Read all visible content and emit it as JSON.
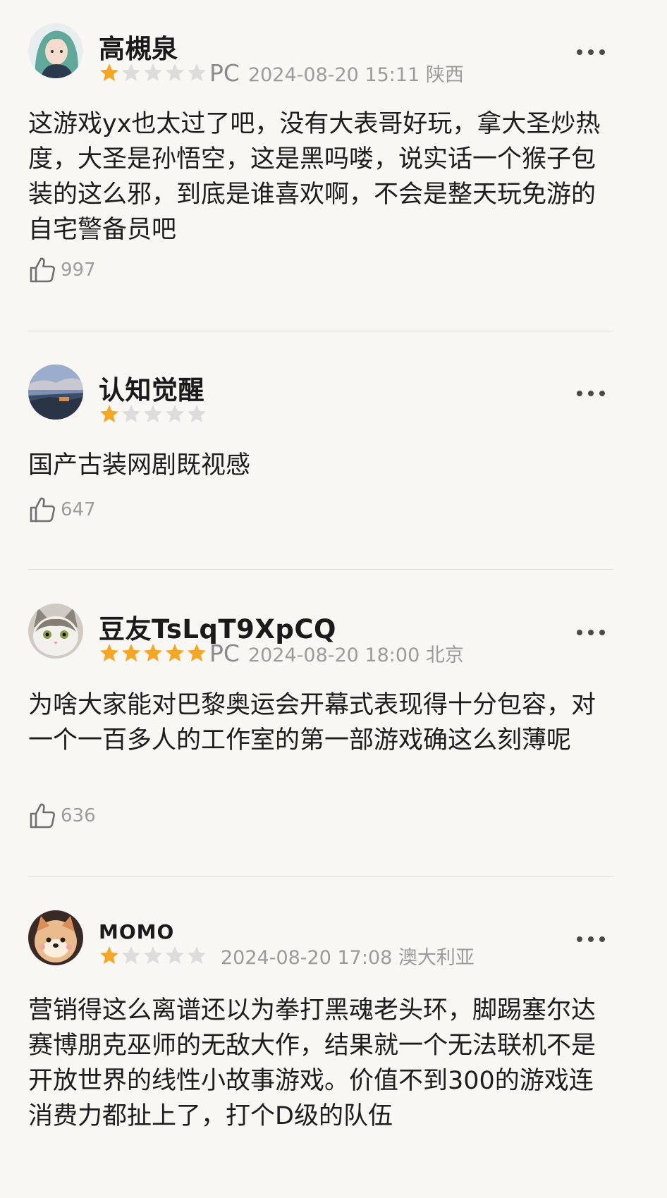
{
  "reviews": [
    {
      "username": "高槻泉",
      "rating": 1,
      "max_rating": 5,
      "platform": "PC",
      "date": "2024-08-20 15:11 陕西",
      "content": "这游戏yx也太过了吧，没有大表哥好玩，拿大圣炒热度，大圣是孙悟空，这是黑吗喽，说实话一个猴子包装的这么邪，到底是谁喜欢啊，不会是整天玩免游的自宅警备员吧",
      "likes": "997"
    },
    {
      "username": "认知觉醒",
      "rating": 1,
      "max_rating": 5,
      "platform": "",
      "date": "",
      "content": "国产古装网剧既视感",
      "likes": "647"
    },
    {
      "username": "豆友TsLqT9XpCQ",
      "rating": 5,
      "max_rating": 5,
      "platform": "PC",
      "date": "2024-08-20 18:00 北京",
      "content": "为啥大家能对巴黎奥运会开幕式表现得十分包容，对一个一百多人的工作室的第一部游戏确这么刻薄呢",
      "likes": "636"
    },
    {
      "username": "MOMO",
      "rating": 1,
      "max_rating": 5,
      "platform": "",
      "date": "2024-08-20 17:08 澳大利亚",
      "content": "营销得这么离谱还以为拳打黑魂老头环，脚踢塞尔达赛博朋克巫师的无敌大作，结果就一个无法联机不是开放世界的线性小故事游戏。价值不到300的游戏连消费力都扯上了，打个D级的队伍",
      "likes": ""
    }
  ],
  "colors": {
    "star_filled": "#f5a623",
    "star_empty": "#dcdcdc",
    "background": "#f9f7f4"
  },
  "icons": {
    "like": "thumbs-up-icon",
    "more": "more-dots-icon",
    "star": "star-icon"
  }
}
